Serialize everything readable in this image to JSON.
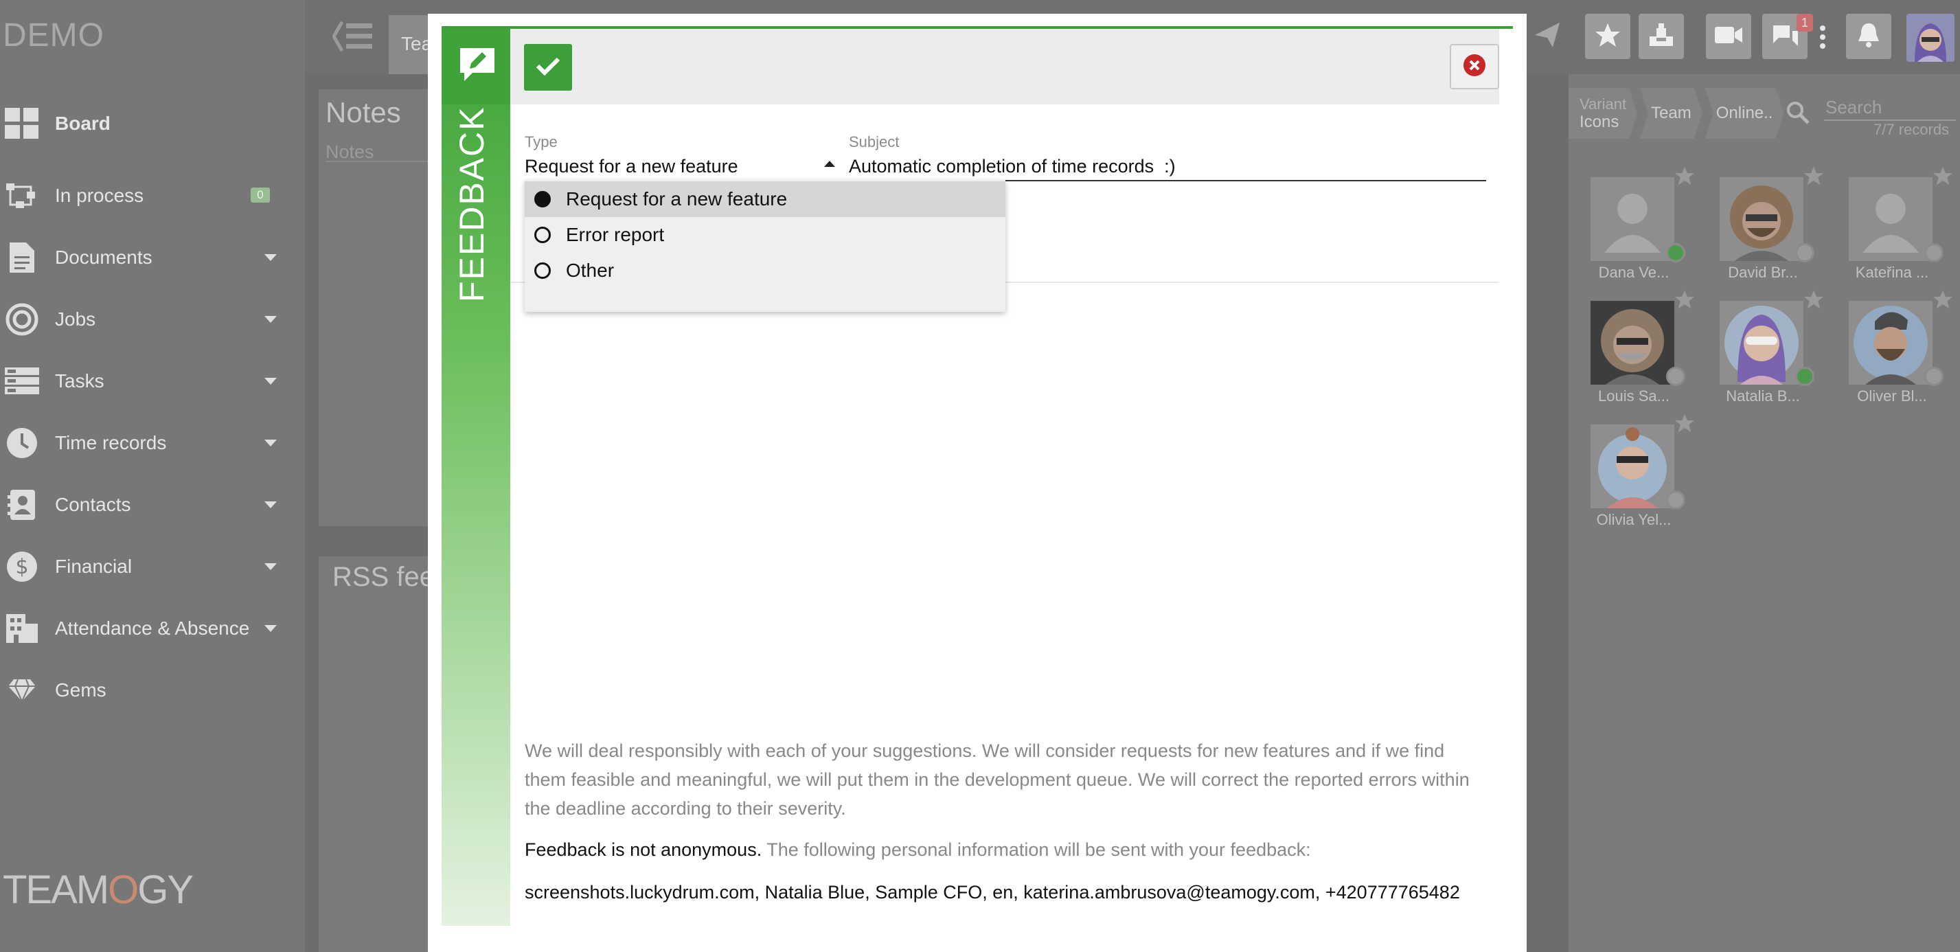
{
  "app": {
    "brand": "DEMO",
    "logo_text": "TEAMOGY"
  },
  "sidebar": {
    "items": [
      {
        "label": "Board",
        "icon": "board-icon"
      },
      {
        "label": "In process",
        "icon": "process-icon",
        "count": "0"
      },
      {
        "label": "Documents",
        "icon": "document-icon",
        "caret": true
      },
      {
        "label": "Jobs",
        "icon": "target-icon",
        "caret": true
      },
      {
        "label": "Tasks",
        "icon": "tasks-icon",
        "caret": true
      },
      {
        "label": "Time records",
        "icon": "clock-icon",
        "caret": true
      },
      {
        "label": "Contacts",
        "icon": "contacts-icon",
        "caret": true
      },
      {
        "label": "Financial",
        "icon": "dollar-icon",
        "caret": true
      },
      {
        "label": "Attendance & Absence",
        "icon": "building-icon",
        "caret": true
      },
      {
        "label": "Gems",
        "icon": "gem-icon"
      }
    ]
  },
  "topbar": {
    "team_tab": "Tea",
    "buttons": [
      "send-icon",
      "star-icon",
      "inbox-icon",
      "video-icon",
      "chat-icon",
      "more-icon",
      "bell-icon"
    ],
    "chat_badge": "1"
  },
  "dashboard": {
    "notes_title": "Notes",
    "notes_placeholder": "Notes",
    "rss_title": "RSS fee"
  },
  "contacts_panel": {
    "breadcrumb": {
      "variant": "Variant",
      "icons": "Icons",
      "team": "Team",
      "online": "Online.."
    },
    "search_placeholder": "Search",
    "record_count": "7/7 records",
    "people": [
      {
        "name": "Dana Ve...",
        "status": "online"
      },
      {
        "name": "David Br...",
        "status": "offline"
      },
      {
        "name": "Kateřina ...",
        "status": "offline"
      },
      {
        "name": "Louis Sa...",
        "status": "offline"
      },
      {
        "name": "Natalia B...",
        "status": "online"
      },
      {
        "name": "Oliver Bl...",
        "status": "offline"
      },
      {
        "name": "Olivia Yel...",
        "status": "offline"
      }
    ]
  },
  "modal": {
    "vertical_title": "FEEDBACK",
    "type_label": "Type",
    "type_value": "Request for a new feature",
    "subject_label": "Subject",
    "subject_value": "Automatic completion of time records  :)",
    "options": [
      {
        "label": "Request for a new feature",
        "selected": true
      },
      {
        "label": "Error report",
        "selected": false
      },
      {
        "label": "Other",
        "selected": false
      }
    ],
    "info_text": "We will deal responsibly with each of your suggestions. We will consider requests for new features and if we find them feasible and meaningful, we will put them in the development queue. We will correct the reported errors within the deadline according to their severity.",
    "anon_strong": "Feedback is not anonymous.",
    "anon_rest": " The following personal information will be sent with your feedback:",
    "personal_info": "screenshots.luckydrum.com, Natalia Blue, Sample CFO, en, katerina.ambrusova@teamogy.com, +420777765482"
  },
  "colors": {
    "accent_green": "#3ca03a",
    "close_red": "#c62828",
    "online_green": "#5cb85c"
  }
}
